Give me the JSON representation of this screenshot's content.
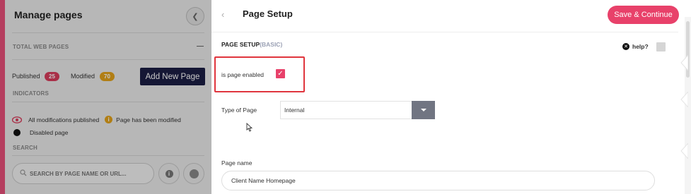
{
  "left_panel": {
    "title": "Manage pages",
    "sections": {
      "total_web_pages": "TOTAL WEB PAGES",
      "indicators": "INDICATORS",
      "search": "SEARCH"
    },
    "stats": {
      "published_label": "Published",
      "published_count": "25",
      "modified_label": "Modified",
      "modified_count": "70"
    },
    "add_button": "Add New Page",
    "indicators": {
      "all_published": "All modifications published",
      "modified": "Page has been modified",
      "disabled": "Disabled page"
    },
    "search_placeholder": "SEARCH BY PAGE NAME OR URL...",
    "colors": {
      "accent": "#e8507a",
      "published_badge": "#d93d5c",
      "modified_badge": "#e3a21a",
      "add_button": "#1b1e44"
    }
  },
  "main": {
    "title": "Page Setup",
    "save_button": "Save & Continue",
    "section_title": "PAGE SETUP",
    "section_subtitle": "(BASIC)",
    "help_label": "help?",
    "enabled": {
      "label": "is page enabled",
      "checked": true
    },
    "type": {
      "label": "Type of Page",
      "value": "Internal"
    },
    "name": {
      "label": "Page name",
      "value": "Client Name Homepage"
    },
    "colors": {
      "save_button": "#e8416a",
      "highlight": "#e0353d",
      "dropdown_button": "#717582"
    }
  }
}
